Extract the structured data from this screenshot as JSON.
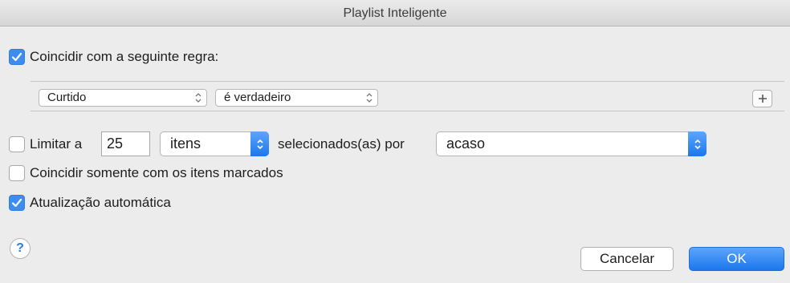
{
  "window": {
    "title": "Playlist Inteligente"
  },
  "match_rule": {
    "label": "Coincidir com a seguinte regra:",
    "checked": true
  },
  "rule": {
    "field": "Curtido",
    "condition": "é verdadeiro",
    "add_icon": "plus-icon"
  },
  "limit": {
    "label": "Limitar a",
    "checked": false,
    "amount": "25",
    "unit": "itens",
    "selected_by_label": "selecionados(as) por",
    "method": "acaso"
  },
  "checked_only": {
    "label": "Coincidir somente com os itens marcados",
    "checked": false
  },
  "live_update": {
    "label": "Atualização automática",
    "checked": true
  },
  "help": {
    "glyph": "?"
  },
  "buttons": {
    "cancel": "Cancelar",
    "ok": "OK"
  },
  "colors": {
    "accent": "#3b8ef0",
    "background": "#ececec"
  }
}
